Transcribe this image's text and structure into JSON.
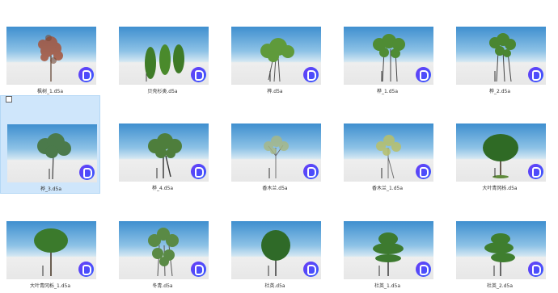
{
  "files": [
    {
      "name": "枫树_1.d5a",
      "tree": "maple"
    },
    {
      "name": "贝壳杉类.d5a",
      "tree": "cypress"
    },
    {
      "name": "桦.d5a",
      "tree": "birch"
    },
    {
      "name": "桦_1.d5a",
      "tree": "birch-tall"
    },
    {
      "name": "桦_2.d5a",
      "tree": "birch-thin"
    },
    {
      "name": "桦_3.d5a",
      "tree": "round-open"
    },
    {
      "name": "桦_4.d5a",
      "tree": "spread"
    },
    {
      "name": "香木兰.d5a",
      "tree": "sparse-bare"
    },
    {
      "name": "香木兰_1.d5a",
      "tree": "sparse-yellow"
    },
    {
      "name": "大叶青冈栎.d5a",
      "tree": "round-dense"
    },
    {
      "name": "大叶青冈栎_1.d5a",
      "tree": "lollipop"
    },
    {
      "name": "冬青.d5a",
      "tree": "shrub"
    },
    {
      "name": "杜英.d5a",
      "tree": "oval-dense"
    },
    {
      "name": "杜英_1.d5a",
      "tree": "conical"
    },
    {
      "name": "杜英_2.d5a",
      "tree": "layered"
    }
  ],
  "selected_index": 5,
  "colors": {
    "sky_top": "#3f8fcf",
    "sky_bottom": "#d3e7f2",
    "ground": "#e7e7e7",
    "badge": "#5a45f8",
    "selection": "#cfe6fb"
  }
}
